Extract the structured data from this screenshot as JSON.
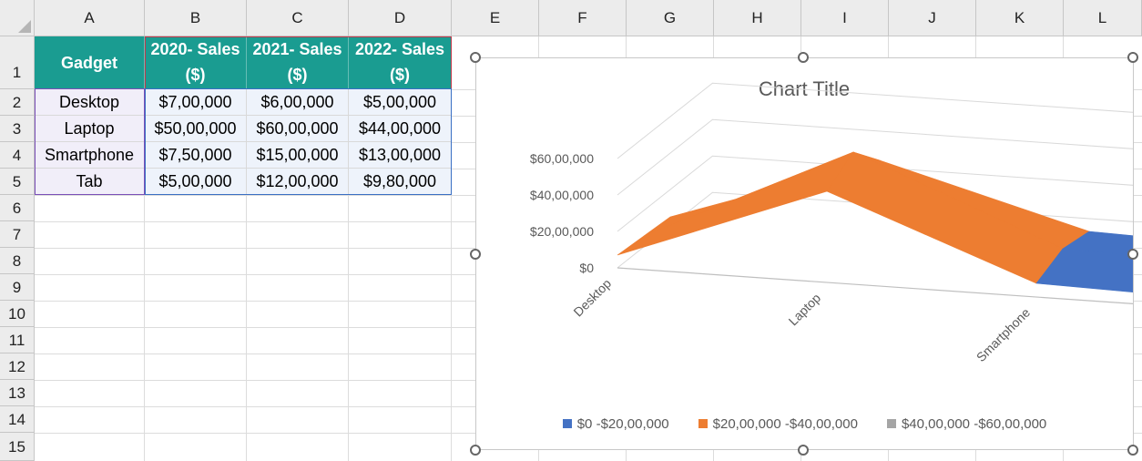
{
  "columns": [
    "A",
    "B",
    "C",
    "D",
    "E",
    "F",
    "G",
    "H",
    "I",
    "J",
    "K",
    "L"
  ],
  "rows": [
    "1",
    "2",
    "3",
    "4",
    "5",
    "6",
    "7",
    "8",
    "9",
    "10",
    "11",
    "12",
    "13",
    "14",
    "15"
  ],
  "table": {
    "headers": [
      [
        "Gadget"
      ],
      [
        "2020- Sales",
        "($)"
      ],
      [
        "2021- Sales",
        "($)"
      ],
      [
        "2022- Sales",
        "($)"
      ]
    ],
    "rows": [
      [
        "Desktop",
        "$7,00,000",
        "$6,00,000",
        "$5,00,000"
      ],
      [
        "Laptop",
        "$50,00,000",
        "$60,00,000",
        "$44,00,000"
      ],
      [
        "Smartphone",
        "$7,50,000",
        "$15,00,000",
        "$13,00,000"
      ],
      [
        "Tab",
        "$5,00,000",
        "$12,00,000",
        "$9,80,000"
      ]
    ]
  },
  "chart_data": {
    "type": "surface",
    "title": "Chart Title",
    "categories": [
      "Desktop",
      "Laptop",
      "Smartphone",
      "Tab"
    ],
    "series": [
      {
        "name": "2020- Sales ($)",
        "values": [
          700000,
          5000000,
          750000,
          500000
        ]
      },
      {
        "name": "2021- Sales ($)",
        "values": [
          600000,
          6000000,
          1500000,
          1200000
        ]
      },
      {
        "name": "2022- Sales ($)",
        "values": [
          500000,
          4400000,
          1300000,
          980000
        ]
      }
    ],
    "z_ticks": [
      "$0",
      "$20,00,000",
      "$40,00,000",
      "$60,00,000"
    ],
    "zlim": [
      0,
      6000000
    ],
    "bands": [
      {
        "label": "$0 -$20,00,000",
        "color": "#4472c4"
      },
      {
        "label": "$20,00,000 -$40,00,000",
        "color": "#ed7d31"
      },
      {
        "label": "$40,00,000 -$60,00,000",
        "color": "#a5a5a5"
      }
    ],
    "legend_position": "bottom",
    "grid": true
  }
}
